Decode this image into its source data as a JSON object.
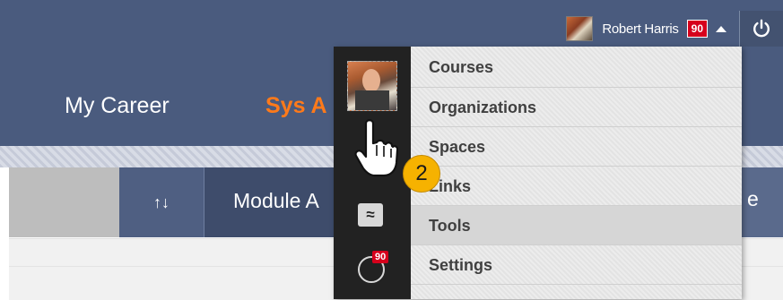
{
  "header": {
    "user_name": "Robert Harris",
    "notification_count": "90",
    "nav": [
      {
        "label": "My Career"
      },
      {
        "label": "Sys A"
      }
    ]
  },
  "toolbar": {
    "sort_label": "↑↓",
    "module_title": "Module A",
    "right_fragment": "e"
  },
  "dropdown": {
    "items": [
      {
        "label": "Courses"
      },
      {
        "label": "Organizations"
      },
      {
        "label": "Spaces"
      },
      {
        "label": "Links"
      },
      {
        "label": "Tools"
      },
      {
        "label": "Settings"
      }
    ],
    "side_icons": [
      "avatar",
      "wave-icon",
      "clock-icon"
    ],
    "side_badge": "90"
  },
  "annotation": {
    "step_number": "2"
  },
  "colors": {
    "header_bg": "#4a5b7e",
    "accent_orange": "#ff7a1a",
    "badge_red": "#d6001c",
    "step_yellow": "#f6b200"
  }
}
